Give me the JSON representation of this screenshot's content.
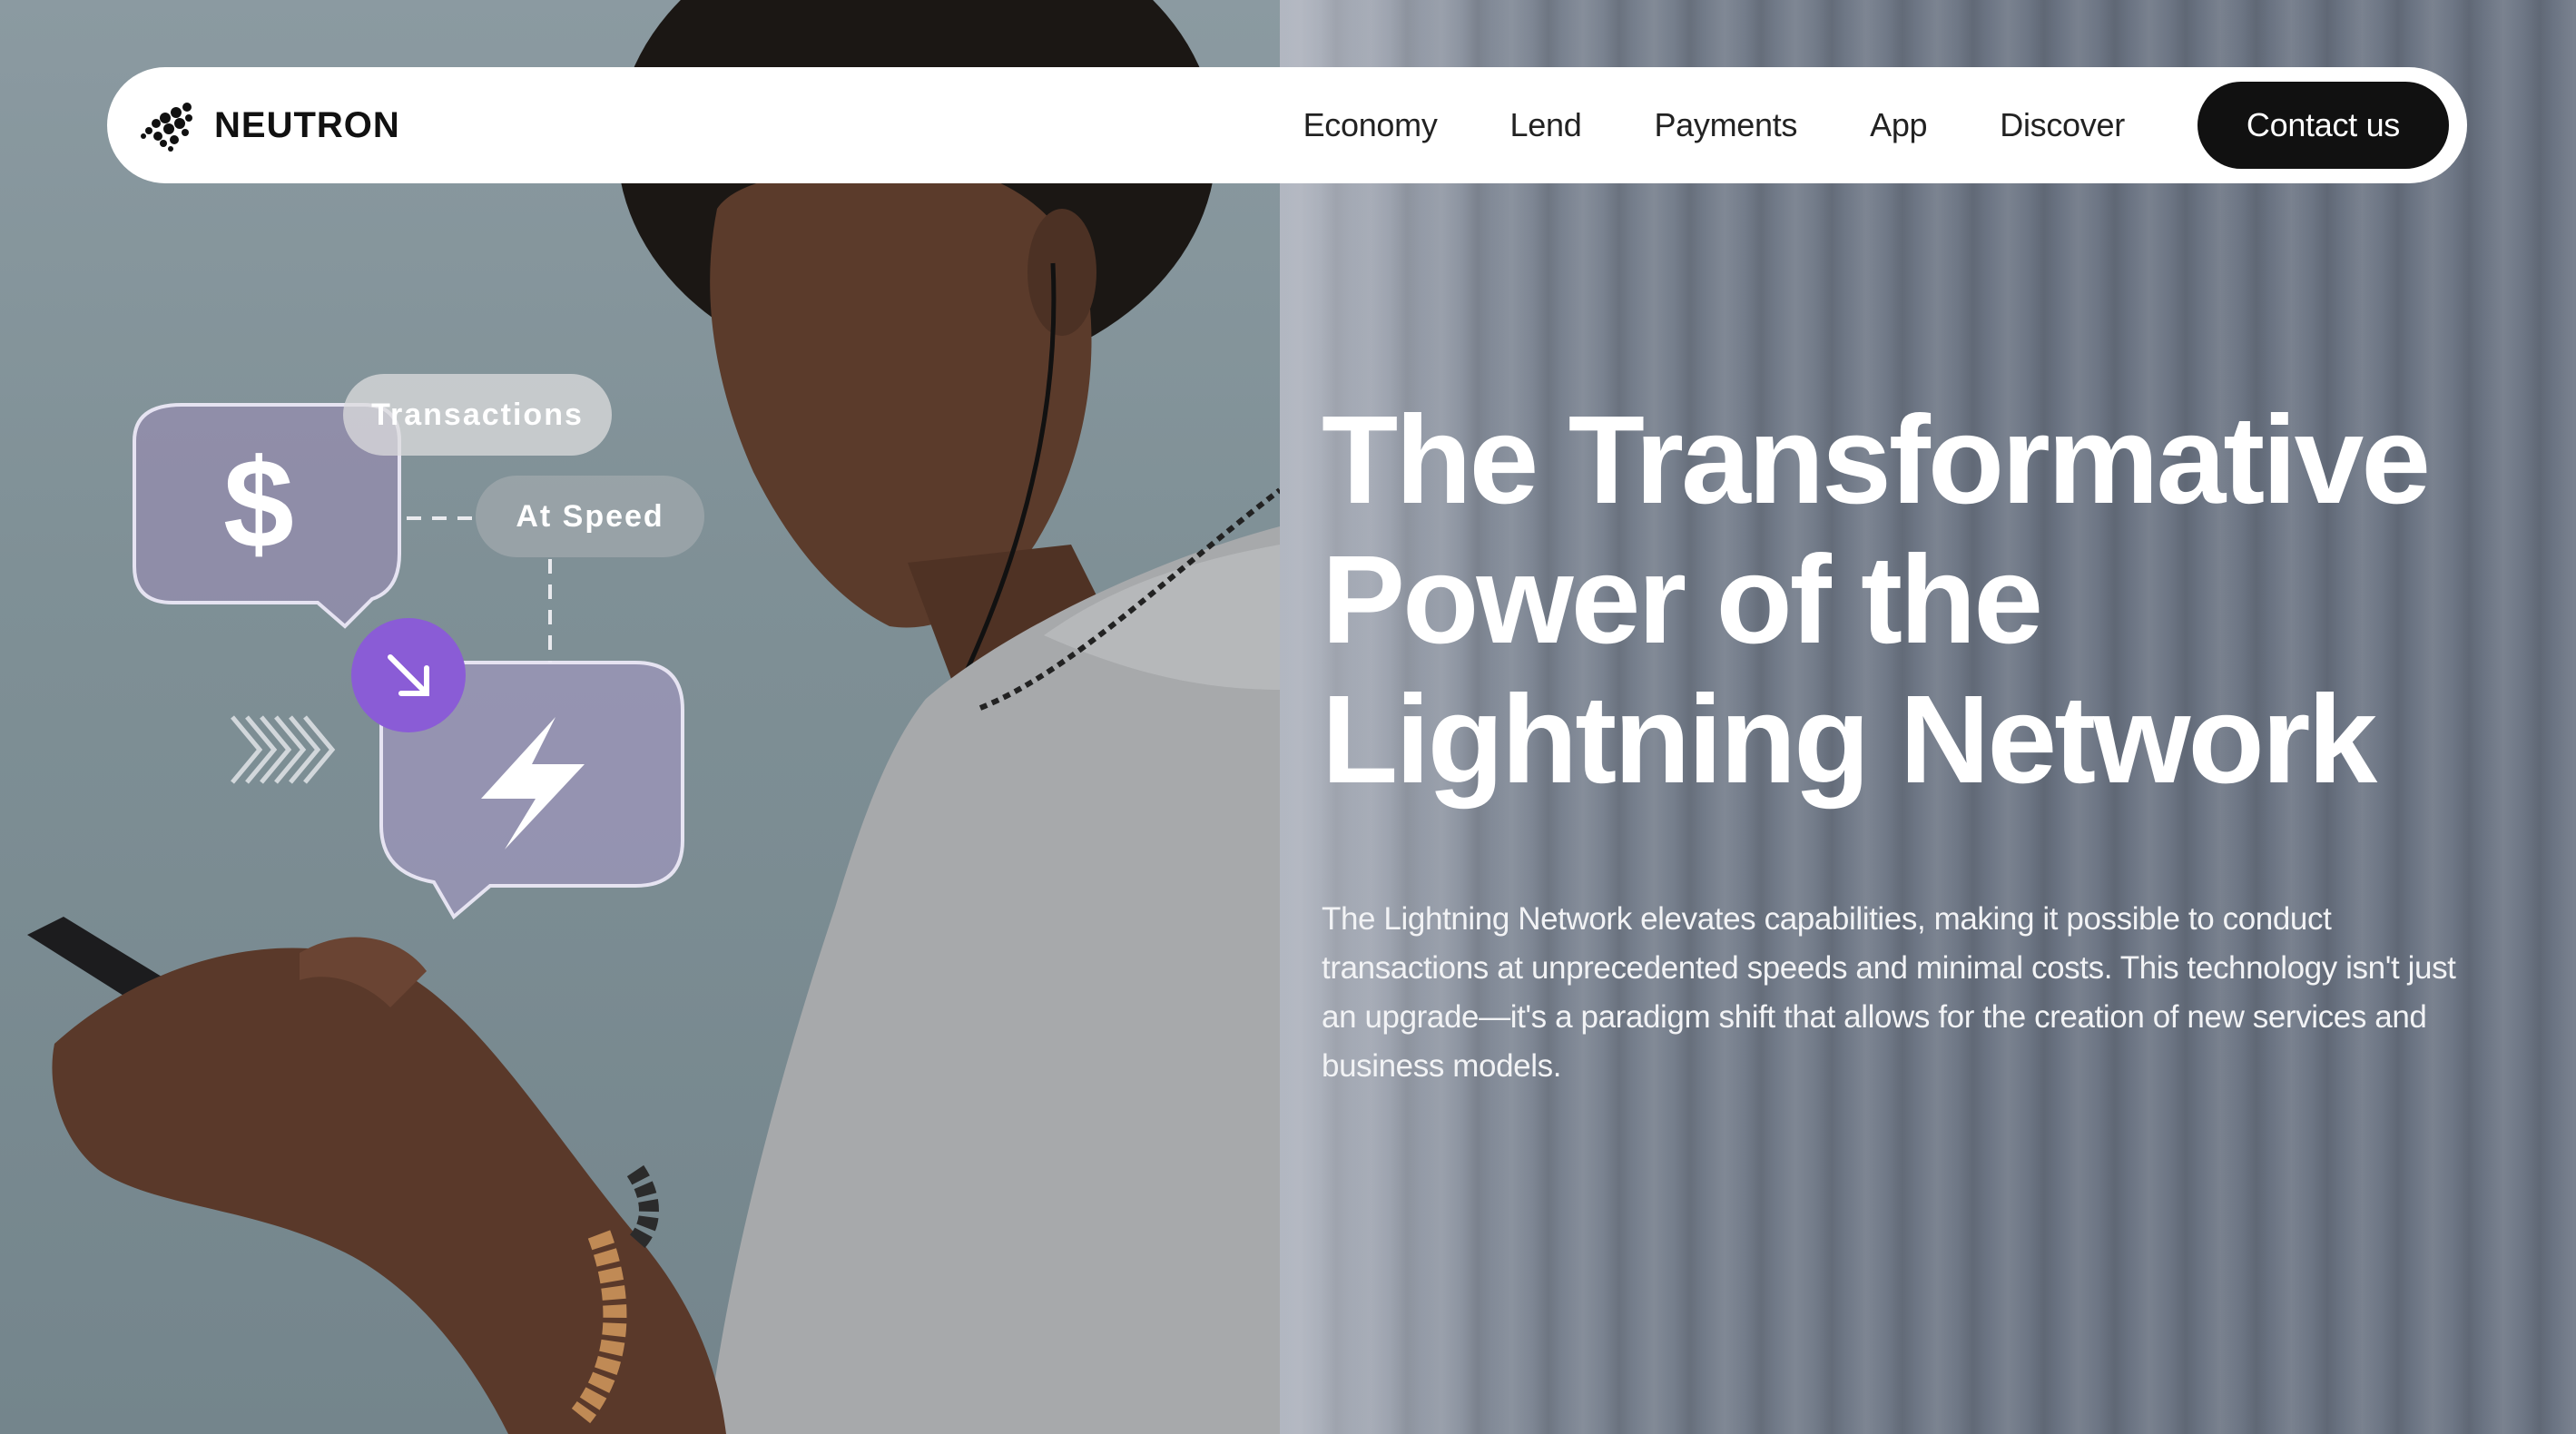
{
  "brand": {
    "name": "NEUTRON"
  },
  "nav": {
    "links": [
      "Economy",
      "Lend",
      "Payments",
      "App",
      "Discover"
    ],
    "cta": "Contact us"
  },
  "hero": {
    "title_lines": [
      "The Transformative",
      "Power of the",
      "Lightning Network"
    ],
    "body": "The Lightning Network elevates capabilities, making it possible to conduct transactions at unprecedented speeds and minimal costs. This technology isn't just an upgrade—it's a paradigm shift that allows for the creation of new services and business models."
  },
  "widgets": {
    "transactions_label": "Transactions",
    "speed_label": "At Speed",
    "dollar_symbol": "$"
  },
  "colors": {
    "accent_purple": "#8a5cd6",
    "bubble_purple": "#a399b8",
    "nav_bg": "#ffffff",
    "cta_bg": "#111111"
  }
}
